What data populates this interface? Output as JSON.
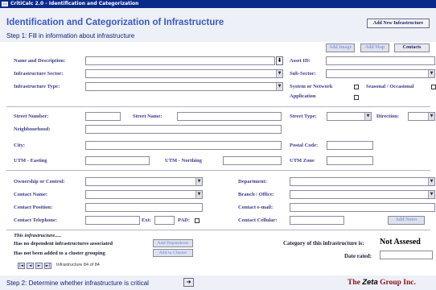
{
  "window": {
    "title": "CritiCalc 2.0 - Identification and Categorization"
  },
  "header": {
    "add_new_label": "Add New Infrastructure",
    "title": "Identification and Categorization of Infrastructure",
    "step1": "Step 1: Fill in information about infrastructure"
  },
  "toolbar": {
    "add_image": "Add Image",
    "add_map": "Add Map",
    "contacts": "Contacts"
  },
  "form": {
    "name_desc": "Name and Description:",
    "asset_id": "Asset ID:",
    "sector": "Infrastructure Sector:",
    "sub_sector": "Sub-Sector:",
    "type": "Infrastructure Type:",
    "system_network": "System or Network",
    "seasonal": "Seasonal / Occasional",
    "application": "Application",
    "street_number": "Street Number:",
    "street_name": "Street Name:",
    "street_type": "Street Type:",
    "direction": "Direction:",
    "neighbourhood": "Neighbourhood:",
    "city": "City:",
    "postal_code": "Postal Code:",
    "utm_easting": "UTM - Easting",
    "utm_northing": "UTM - Northing",
    "utm_zone": "UTM Zone",
    "ownership": "Ownership or Control:",
    "department": "Department:",
    "contact_name": "Contact Name:",
    "branch": "Branch / Office:",
    "contact_position": "Contact Position:",
    "contact_email": "Contact e-mail:",
    "contact_phone": "Contact Telephone:",
    "ext": "Ext:",
    "pad": "PAD:",
    "contact_cell": "Contact Cellular:",
    "add_notes": "Add Notes"
  },
  "status": {
    "this_infra": "This infrastructure.....",
    "no_dependents": "Has no dependent infrastructures associated",
    "no_cluster": "Has not been added to a cluster grouping",
    "add_dependents": "Add Dependents",
    "add_to_cluster": "Add to Cluster",
    "category_label": "Category of this infrastructure is:",
    "category_value": "Not Assesed",
    "date_rated": "Date rated:"
  },
  "nav": {
    "record_text": "Infrastructure 84 of 84"
  },
  "footer": {
    "step2": "Step 2: Determine whether infrastructure is critical",
    "brand_prefix": "The ",
    "brand_name": "Zeta",
    "brand_suffix": " Group Inc."
  }
}
